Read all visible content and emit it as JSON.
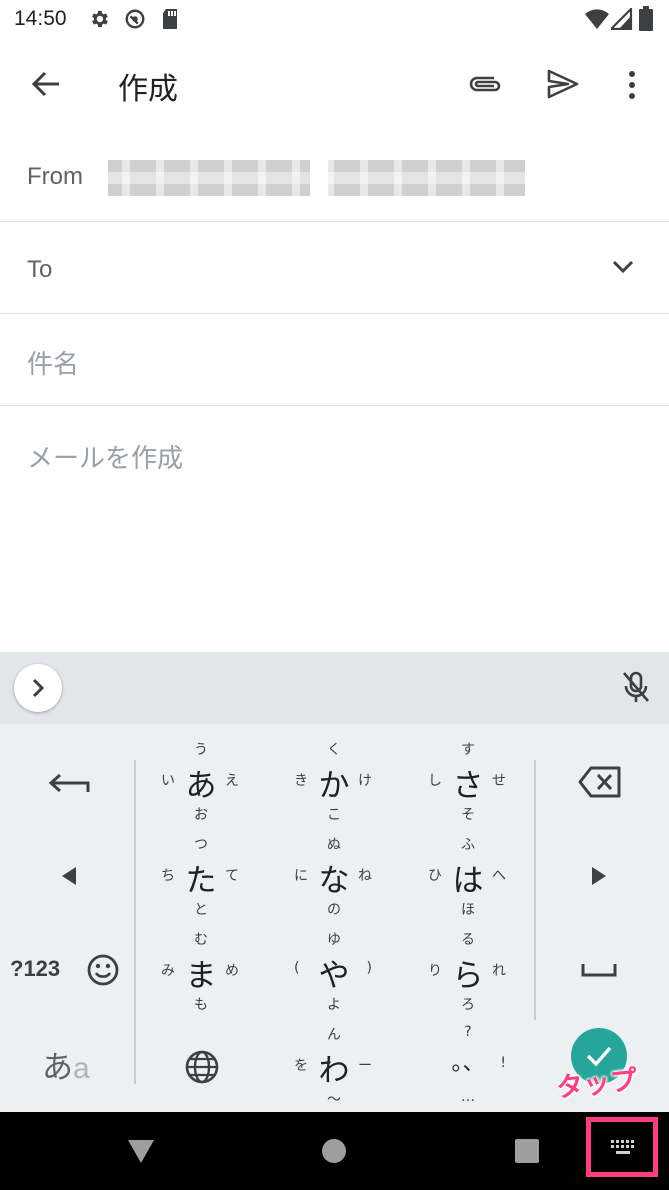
{
  "status_bar": {
    "time": "14:50"
  },
  "app_bar": {
    "title": "作成"
  },
  "compose": {
    "from_label": "From",
    "to_label": "To",
    "subject_placeholder": "件名",
    "body_placeholder": "メールを作成"
  },
  "keyboard": {
    "rows": [
      [
        {
          "main": "あ",
          "top": "う",
          "left": "い",
          "right": "え",
          "bottom": "お"
        },
        {
          "main": "か",
          "top": "く",
          "left": "き",
          "right": "け",
          "bottom": "こ"
        },
        {
          "main": "さ",
          "top": "す",
          "left": "し",
          "right": "せ",
          "bottom": "そ"
        }
      ],
      [
        {
          "main": "た",
          "top": "つ",
          "left": "ち",
          "right": "て",
          "bottom": "と"
        },
        {
          "main": "な",
          "top": "ぬ",
          "left": "に",
          "right": "ね",
          "bottom": "の"
        },
        {
          "main": "は",
          "top": "ふ",
          "left": "ひ",
          "right": "へ",
          "bottom": "ほ"
        }
      ],
      [
        {
          "main": "ま",
          "top": "む",
          "left": "み",
          "right": "め",
          "bottom": "も"
        },
        {
          "main": "や",
          "top": "ゆ",
          "left": "(",
          "right": ")",
          "bottom": "よ"
        },
        {
          "main": "ら",
          "top": "る",
          "left": "り",
          "right": "れ",
          "bottom": "ろ"
        }
      ],
      [
        {
          "main": "わ",
          "top": "ん",
          "left": "を",
          "right": "ー",
          "bottom": "〜"
        },
        {
          "main": "。、",
          "top": "?",
          "left": "",
          "right": "!",
          "bottom": "…"
        }
      ]
    ],
    "numeric_label": "?123",
    "mode_label_main": "あ",
    "mode_label_sub": "a",
    "annotation": "タップ",
    "accent_color": "#26a69a",
    "highlight_color": "#ff3d7f"
  }
}
